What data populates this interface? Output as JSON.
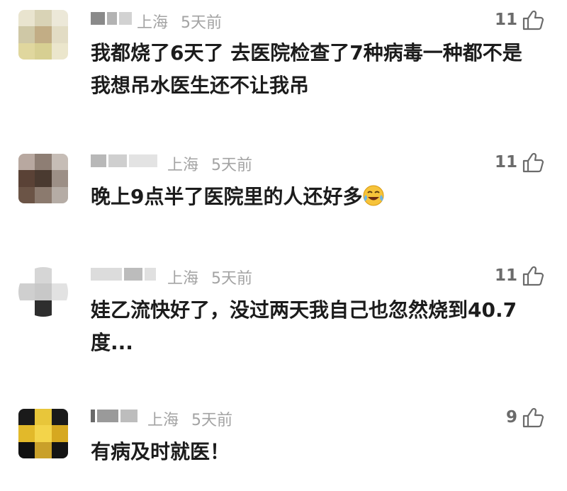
{
  "comments": [
    {
      "location": "上海",
      "time": "5天前",
      "likes": "11",
      "text": "我都烧了6天了 去医院检查了7种病毒一种都不是 我想吊水医生还不让我吊"
    },
    {
      "location": "上海",
      "time": "5天前",
      "likes": "11",
      "text": "晚上9点半了医院里的人还好多",
      "emoji": "laughing-crying-emoji-icon"
    },
    {
      "location": "上海",
      "time": "5天前",
      "likes": "11",
      "text": "娃乙流快好了，没过两天我自己也忽然烧到40.7度..."
    },
    {
      "location": "上海",
      "time": "5天前",
      "likes": "9",
      "text": "有病及时就医！"
    }
  ],
  "icons": {
    "like": "thumbs-up-icon"
  },
  "colors": {
    "meta": "#a3a3a3",
    "text": "#1c1c1c",
    "likes": "#6b6b6b"
  }
}
